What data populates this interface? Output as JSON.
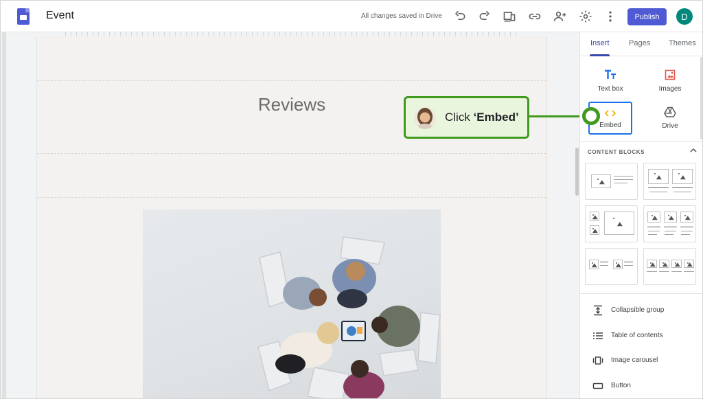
{
  "app": {
    "doc_title": "Event",
    "save_status": "All changes saved in Drive",
    "publish_label": "Publish",
    "avatar_initial": "D"
  },
  "editor": {
    "section_heading": "Reviews"
  },
  "tooltip": {
    "prefix": "Click ",
    "target": "‘Embed’"
  },
  "panel": {
    "tabs": [
      "Insert",
      "Pages",
      "Themes"
    ],
    "tools": [
      {
        "label": "Text box",
        "icon": "text-box-icon"
      },
      {
        "label": "Images",
        "icon": "images-icon"
      },
      {
        "label": "Embed",
        "icon": "embed-icon"
      },
      {
        "label": "Drive",
        "icon": "drive-icon"
      }
    ],
    "content_blocks_title": "CONTENT BLOCKS",
    "list": [
      {
        "label": "Collapsible group",
        "icon": "collapsible-group-icon"
      },
      {
        "label": "Table of contents",
        "icon": "table-of-contents-icon"
      },
      {
        "label": "Image carousel",
        "icon": "image-carousel-icon"
      },
      {
        "label": "Button",
        "icon": "button-icon"
      }
    ]
  },
  "colors": {
    "accent": "#4f5bd5",
    "tab_active": "#3949ab",
    "callout_border": "#3f9a1d",
    "callout_fill": "#eaf5de",
    "avatar": "#00897b"
  }
}
